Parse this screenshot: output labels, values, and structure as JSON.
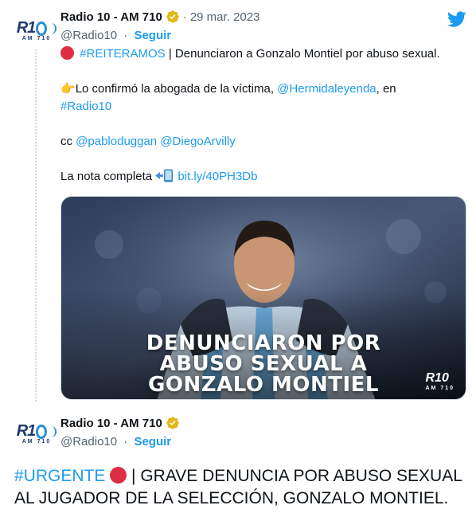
{
  "tweet1": {
    "avatar_logo": "R10",
    "avatar_sub": "AM 710",
    "name": "Radio 10 - AM 710",
    "date": "29 mar. 2023",
    "handle": "@Radio10",
    "separator": "·",
    "follow_label": "Seguir",
    "line1_hashtag": "#REITERAMOS",
    "line1_text": " | Denunciaron a Gonzalo Montiel por abuso sexual.",
    "line2_emoji": "👉",
    "line2_text": "Lo confirmó la abogada de la víctima, ",
    "line2_mention": "@Hermidaleyenda",
    "line2_suffix": ", en",
    "line3_hashtag": "#Radio10",
    "line4_prefix": "cc ",
    "line4_mention1": "@pabloduggan",
    "line4_mention2": "@DiegoArvilly",
    "line5_text": "La nota completa ",
    "line5_link": "bit.ly/40PH3Db",
    "media": {
      "caption_line1": "DENUNCIARON POR",
      "caption_line2": "ABUSO SEXUAL A",
      "caption_line3": "GONZALO MONTIEL",
      "logo": "R10",
      "logo_sub": "AM 710"
    }
  },
  "tweet2": {
    "avatar_logo": "R10",
    "avatar_sub": "AM 710",
    "name": "Radio 10 - AM 710",
    "handle": "@Radio10",
    "separator": "·",
    "follow_label": "Seguir",
    "hashtag": "#URGENTE",
    "text_line1": " | GRAVE DENUNCIA POR ABUSO SEXUAL",
    "text_line2": "AL JUGADOR DE LA SELECCIÓN, GONZALO MONTIEL."
  },
  "colors": {
    "link": "#1d9bf0",
    "verified": "#e2b719",
    "red_circle": "#dd2e44",
    "twitter_blue": "#1d9bf0"
  }
}
